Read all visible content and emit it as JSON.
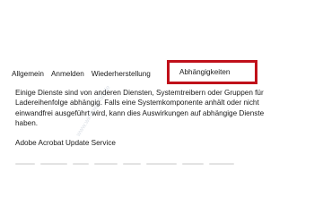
{
  "tabs": {
    "items": [
      "Allgemein",
      "Anmelden",
      "Wiederherstellung"
    ],
    "active": "Abhängigkeiten"
  },
  "content": {
    "description": "Einige Dienste sind von anderen Diensten, Systemtreibern oder Gruppen für\nLadereihenfolge abhängig. Falls eine Systemkomponente anhält oder nicht\neinwandfrei ausgeführt wird, kann dies Auswirkungen auf abhängige Dienste\nhaben.",
    "service_name": "Adobe Acrobat Update Service"
  },
  "watermark": "www.windows-faq.de",
  "colors": {
    "highlight_border": "#c0101a",
    "text": "#1a1a1a",
    "background": "#ffffff"
  }
}
